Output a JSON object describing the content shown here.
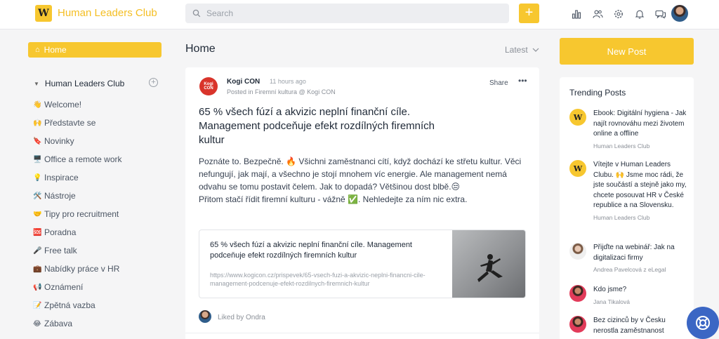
{
  "header": {
    "logo_letter": "W",
    "brand": "Human Leaders Club",
    "search_placeholder": "Search",
    "add_label": "+",
    "icons": [
      "chart-icon",
      "members-icon",
      "settings-icon",
      "bell-icon",
      "messages-icon"
    ]
  },
  "sidebar": {
    "home_label": "Home",
    "group_title": "Human Leaders Club",
    "items": [
      {
        "icon": "👋",
        "label": "Welcome!"
      },
      {
        "icon": "🙌",
        "label": "Představte se"
      },
      {
        "icon": "🔖",
        "label": "Novinky"
      },
      {
        "icon": "🖥️",
        "label": "Office a remote work"
      },
      {
        "icon": "💡",
        "label": "Inspirace"
      },
      {
        "icon": "🛠️",
        "label": "Nástroje"
      },
      {
        "icon": "🤝",
        "label": "Tipy pro recruitment"
      },
      {
        "icon": "🆘",
        "label": "Poradna"
      },
      {
        "icon": "🎤",
        "label": "Free talk"
      },
      {
        "icon": "💼",
        "label": "Nabídky práce v HR"
      },
      {
        "icon": "📢",
        "label": "Oznámení"
      },
      {
        "icon": "📝",
        "label": "Zpětná vazba"
      },
      {
        "icon": "😂",
        "label": "Zábava"
      }
    ]
  },
  "main": {
    "title": "Home",
    "sort_label": "Latest",
    "post": {
      "avatar_text_1": "Kogi",
      "avatar_text_2": "CON",
      "author": "Kogi CON",
      "time": "11 hours ago",
      "posted_in": "Posted in Firemní kultura @ Kogi CON",
      "share_label": "Share",
      "more_label": "•••",
      "title": "65 % všech fúzí a akvizic neplní finanční cíle. Management podceňuje efekt rozdílných firemních kultur",
      "body_line1": "Poznáte to. Bezpečně. 🔥 Všichni zaměstnanci cítí, když dochází ke střetu kultur. Věci nefungují, jak mají, a všechno je stojí mnohem víc energie. Ale management nemá odvahu se tomu postavit čelem. Jak to dopadá? Většinou dost blbě.😒",
      "body_line2": "Přitom stačí řídit firemní kulturu - vážně ✅. Nehledejte za ním nic extra.",
      "link_title": "65 % všech fúzí a akvizic neplní finanční cíle. Management podceňuje efekt rozdílných firemních kultur",
      "link_url": "https://www.kogicon.cz/prispevek/65-vsech-fuzi-a-akvizic-neplni-financni-cile-management-podcenuje-efekt-rozdilnych-firemnich-kultur",
      "liked_by": "Liked by Ondra"
    }
  },
  "right": {
    "new_post_label": "New Post",
    "trending_title": "Trending Posts",
    "items": [
      {
        "title": "Ebook: Digitální hygiena - Jak najít rovnováhu mezi životem online a offline",
        "source": "Human Leaders Club"
      },
      {
        "title": "Vítejte v Human Leaders Clubu. 🙌 Jsme moc rádi, že jste součástí a stejně jako my, chcete posouvat HR v České republice a na Slovensku.",
        "source": "Human Leaders Club"
      },
      {
        "title": "Přijďte na webinář: Jak na digitalizaci firmy",
        "source": "Andrea Pavelcová z eLegal"
      },
      {
        "title": "Kdo jsme?",
        "source": "Jana Tikalová"
      },
      {
        "title": "Bez cizinců by v Česku nerostla zaměstnanost",
        "source": ""
      }
    ]
  },
  "colors": {
    "accent": "#f7c72f",
    "brand_text": "#f4be23",
    "help_button": "#3b66c4"
  }
}
